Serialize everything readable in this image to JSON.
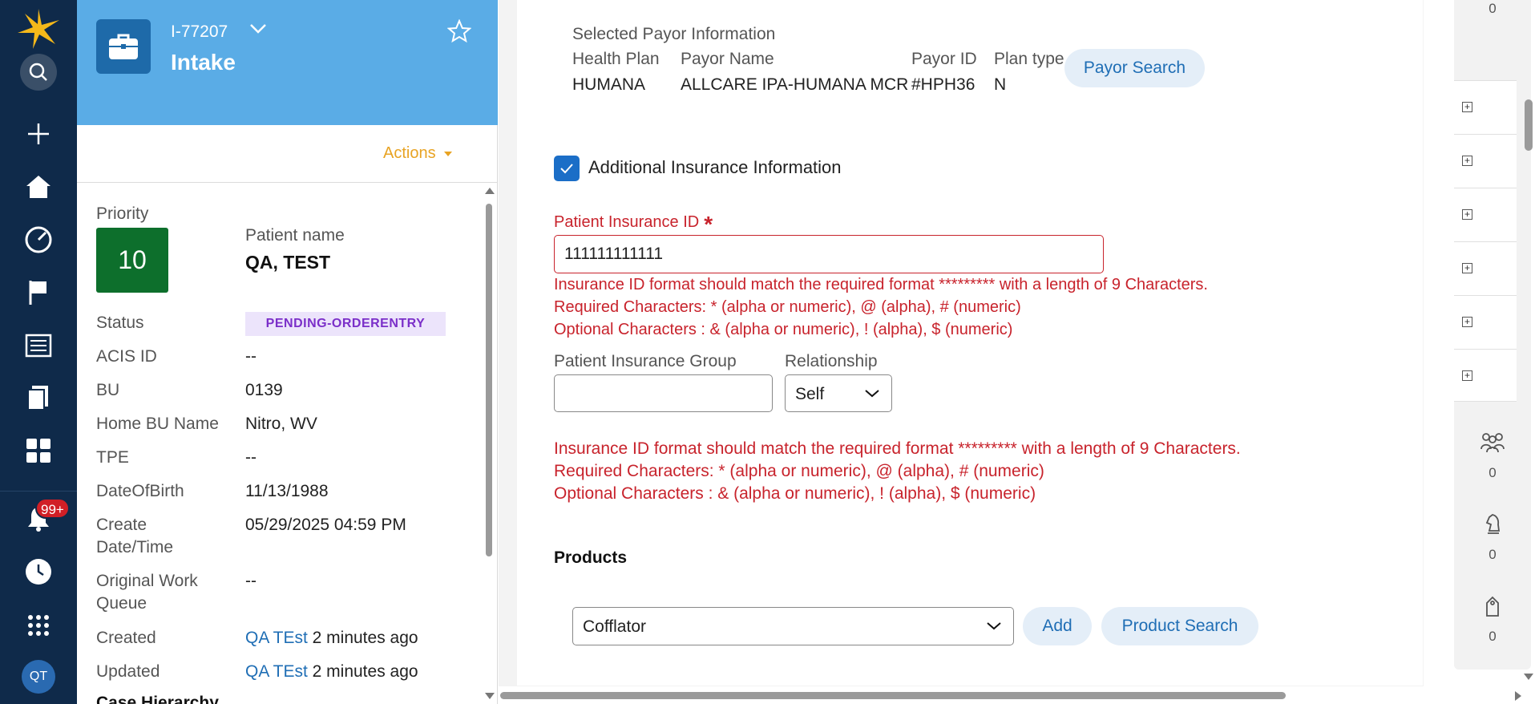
{
  "nav": {
    "items": [
      "search-icon",
      "plus-icon",
      "home-icon",
      "dashboard-icon",
      "flag-icon",
      "news-icon",
      "documents-icon",
      "apps-grid-icon",
      "bell-icon",
      "history-icon",
      "launcher-icon"
    ],
    "notification_count": "99+",
    "user_initials": "QT"
  },
  "case": {
    "id": "I-77207",
    "type": "Intake",
    "actions_label": "Actions",
    "priority_label": "Priority",
    "priority_value": "10",
    "patient_name_label": "Patient name",
    "patient_name": "QA, TEST",
    "fields": [
      {
        "label": "Status",
        "value": "PENDING-ORDERENTRY"
      },
      {
        "label": "ACIS ID",
        "value": "--"
      },
      {
        "label": "BU",
        "value": "0139"
      },
      {
        "label": "Home BU Name",
        "value": "Nitro, WV"
      },
      {
        "label": "TPE",
        "value": "--"
      },
      {
        "label": "DateOfBirth",
        "value": "11/13/1988"
      },
      {
        "label": "Create Date/Time",
        "value": "05/29/2025 04:59 PM"
      },
      {
        "label": "Original Work Queue",
        "value": "--"
      }
    ],
    "created": {
      "label": "Created",
      "user": "QA TEst",
      "when": "2 minutes ago"
    },
    "updated": {
      "label": "Updated",
      "user": "QA TEst",
      "when": "2 minutes ago"
    },
    "next_section_partial": "Case Hierarchy"
  },
  "payor": {
    "section_title": "Selected Payor Information",
    "headers": [
      "Health Plan",
      "Payor Name",
      "Payor ID",
      "Plan type"
    ],
    "values": [
      "HUMANA",
      "ALLCARE IPA-HUMANA MCR",
      "#HPH36",
      "N"
    ],
    "search_button": "Payor Search"
  },
  "insurance": {
    "additional_label": "Additional Insurance Information",
    "additional_checked": true,
    "patient_id_label": "Patient Insurance ID",
    "patient_id_value": "111111111111",
    "error_lines": [
      "Insurance ID format should match the required format ********* with a length of 9 Characters.",
      "Required Characters: * (alpha or numeric), @ (alpha), # (numeric)",
      "Optional Characters : & (alpha or numeric), ! (alpha), $ (numeric)"
    ],
    "group_label": "Patient Insurance Group",
    "group_value": "",
    "relationship_label": "Relationship",
    "relationship_value": "Self"
  },
  "products": {
    "title": "Products",
    "selected": "Cofflator",
    "add_button": "Add",
    "search_button": "Product Search"
  },
  "rail": {
    "counts": [
      "0",
      "0",
      "0",
      "0"
    ]
  },
  "colors": {
    "nav_bg": "#0f2a4a",
    "header_bg": "#5aace6",
    "priority_bg": "#0d6f2c",
    "error": "#c8232c",
    "link": "#1f6eb5",
    "actions": "#e8a323",
    "status_text": "#7b2fc9"
  }
}
